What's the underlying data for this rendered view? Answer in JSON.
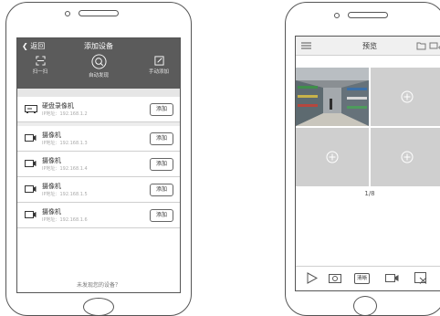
{
  "add_device_screen": {
    "back_label": "返回",
    "title": "添加设备",
    "actions": [
      {
        "label": "扫一扫",
        "icon": "scan-icon"
      },
      {
        "label": "自动发现",
        "icon": "search-icon"
      },
      {
        "label": "手动添加",
        "icon": "edit-icon"
      }
    ],
    "devices": [
      {
        "name": "硬盘录像机",
        "ip": "IP地址：192.168.1.2",
        "type": "dvr-icon",
        "add_label": "添加"
      },
      {
        "name": "摄像机",
        "ip": "IP地址：192.168.1.3",
        "type": "camera-icon",
        "add_label": "添加"
      },
      {
        "name": "摄像机",
        "ip": "IP地址：192.168.1.4",
        "type": "camera-icon",
        "add_label": "添加"
      },
      {
        "name": "摄像机",
        "ip": "IP地址：192.168.1.5",
        "type": "camera-icon",
        "add_label": "添加"
      },
      {
        "name": "摄像机",
        "ip": "IP地址：192.168.1.6",
        "type": "camera-icon",
        "add_label": "添加"
      }
    ],
    "footer_text": "未发现您的设备？"
  },
  "preview_screen": {
    "title": "预览",
    "page_indicator": "1/8",
    "hd_label": "清晰",
    "toolbar_icons": [
      "play-icon",
      "snapshot-icon",
      "hd-button",
      "record-icon",
      "close-all-icon"
    ]
  },
  "colors": {
    "header_dark": "#5b5b5b",
    "band_gray": "#e6e6e6",
    "cell_gray": "#cfcfcf",
    "outline": "#555555"
  }
}
